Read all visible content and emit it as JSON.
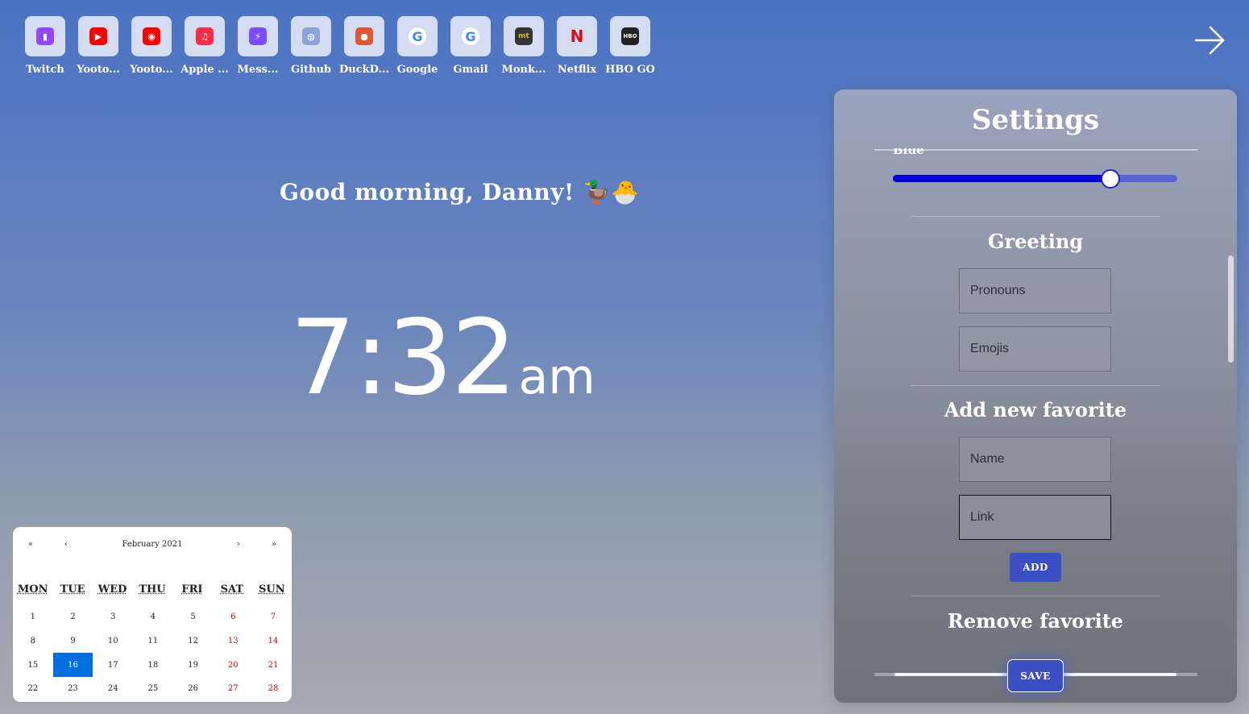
{
  "favorites": [
    {
      "label": "Twitch",
      "icon": "twitch-icon",
      "color": "#9146ff"
    },
    {
      "label": "Yooto...",
      "icon": "youtube-icon",
      "color": "#ff0000"
    },
    {
      "label": "Yooto...",
      "icon": "youtube-music-icon",
      "color": "#ff0000"
    },
    {
      "label": "Apple ...",
      "icon": "apple-music-icon",
      "color": "#fa2d48"
    },
    {
      "label": "Mess...",
      "icon": "messenger-icon",
      "color": "#7b4dff"
    },
    {
      "label": "Github",
      "icon": "globe-icon",
      "color": "#8ea4d8"
    },
    {
      "label": "DuckD...",
      "icon": "duckduckgo-icon",
      "color": "#de5833"
    },
    {
      "label": "Google",
      "icon": "google-icon",
      "color": "#4285f4"
    },
    {
      "label": "Gmail",
      "icon": "google-icon",
      "color": "#4285f4"
    },
    {
      "label": "Monk...",
      "icon": "monkeytype-icon",
      "color": "#e2b714"
    },
    {
      "label": "Netflix",
      "icon": "netflix-icon",
      "color": "#e50914"
    },
    {
      "label": "HBO GO",
      "icon": "hbo-icon",
      "color": "#222222"
    }
  ],
  "greeting": "Good morning, Danny! 🦆🐣",
  "clock": {
    "time": "7:32",
    "ampm": "am"
  },
  "calendar": {
    "prev_year": "«",
    "prev_month": "‹",
    "month_label": "February 2021",
    "next_month": "›",
    "next_year": "»",
    "weekdays": [
      "MON",
      "TUE",
      "WED",
      "THU",
      "FRI",
      "SAT",
      "SUN"
    ],
    "days": [
      "1",
      "2",
      "3",
      "4",
      "5",
      "6",
      "7",
      "8",
      "9",
      "10",
      "11",
      "12",
      "13",
      "14",
      "15",
      "16",
      "17",
      "18",
      "19",
      "20",
      "21",
      "22",
      "23",
      "24",
      "25",
      "26",
      "27",
      "28"
    ],
    "today": "16"
  },
  "settings": {
    "title": "Settings",
    "color_label": "Blue",
    "blue_slider_fraction": 0.765,
    "greeting_title": "Greeting",
    "pronouns_placeholder": "Pronouns",
    "emojis_placeholder": "Emojis",
    "add_title": "Add new favorite",
    "name_placeholder": "Name",
    "link_placeholder": "Link",
    "add_label": "ADD",
    "remove_title": "Remove favorite",
    "save_label": "SAVE"
  },
  "colors": {
    "slider_fill": "#0000d6",
    "button": "#3b4fc4",
    "today": "#006edc",
    "weekend": "#d10000"
  }
}
